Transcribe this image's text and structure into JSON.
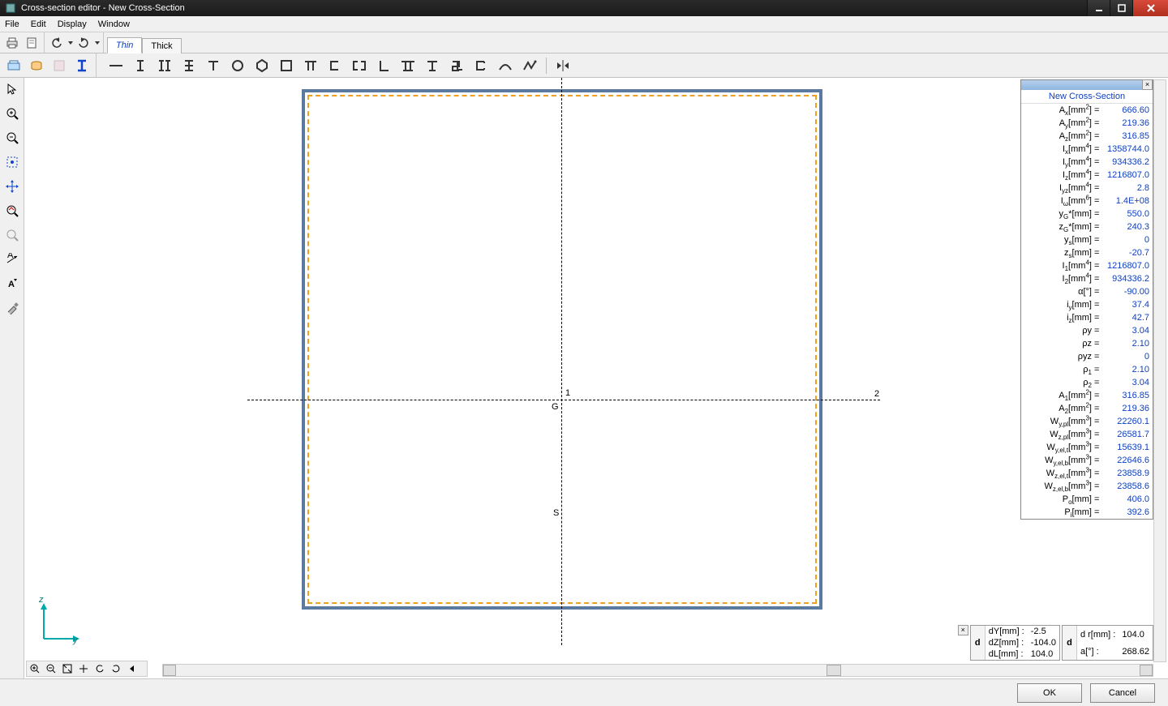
{
  "title": "Cross-section editor - New Cross-Section",
  "menus": [
    "File",
    "Edit",
    "Display",
    "Window"
  ],
  "tabs": {
    "thin": "Thin",
    "thick": "Thick"
  },
  "footer": {
    "ok": "OK",
    "cancel": "Cancel"
  },
  "section_name": "New Cross-Section",
  "canvas_labels": {
    "one": "1",
    "two": "2",
    "G": "G",
    "S": "S",
    "z": "z",
    "y": "y"
  },
  "properties": [
    {
      "label": "A<sub>x</sub>[mm<sup>2</sup>] =",
      "value": "666.60"
    },
    {
      "label": "A<sub>y</sub>[mm<sup>2</sup>] =",
      "value": "219.36"
    },
    {
      "label": "A<sub>z</sub>[mm<sup>2</sup>] =",
      "value": "316.85"
    },
    {
      "label": "I<sub>x</sub>[mm<sup>4</sup>] =",
      "value": "1358744.0"
    },
    {
      "label": "I<sub>y</sub>[mm<sup>4</sup>] =",
      "value": "934336.2"
    },
    {
      "label": "I<sub>z</sub>[mm<sup>4</sup>] =",
      "value": "1216807.0"
    },
    {
      "label": "I<sub>yz</sub>[mm<sup>4</sup>] =",
      "value": "2.8"
    },
    {
      "label": "I<sub>ω</sub>[mm<sup>6</sup>] =",
      "value": "1.4E+08"
    },
    {
      "label": "y<sub>G</sub>*[mm] =",
      "value": "550.0"
    },
    {
      "label": "z<sub>G</sub>*[mm] =",
      "value": "240.3"
    },
    {
      "label": "y<sub>s</sub>[mm] =",
      "value": "0"
    },
    {
      "label": "z<sub>s</sub>[mm] =",
      "value": "-20.7"
    },
    {
      "label": "I<sub>1</sub>[mm<sup>4</sup>] =",
      "value": "1216807.0"
    },
    {
      "label": "I<sub>2</sub>[mm<sup>4</sup>] =",
      "value": "934336.2"
    },
    {
      "label": "α[°] =",
      "value": "-90.00"
    },
    {
      "label": "i<sub>y</sub>[mm] =",
      "value": "37.4"
    },
    {
      "label": "i<sub>z</sub>[mm] =",
      "value": "42.7"
    },
    {
      "label": "ρy =",
      "value": "3.04"
    },
    {
      "label": "ρz =",
      "value": "2.10"
    },
    {
      "label": "ρyz =",
      "value": "0"
    },
    {
      "label": "ρ<sub>1</sub> =",
      "value": "2.10"
    },
    {
      "label": "ρ<sub>2</sub> =",
      "value": "3.04"
    },
    {
      "label": "A<sub>1</sub>[mm<sup>2</sup>] =",
      "value": "316.85"
    },
    {
      "label": "A<sub>2</sub>[mm<sup>2</sup>] =",
      "value": "219.36"
    },
    {
      "label": "W<sub>y,pl</sub>[mm<sup>3</sup>] =",
      "value": "22260.1"
    },
    {
      "label": "W<sub>z,pl</sub>[mm<sup>3</sup>] =",
      "value": "26581.7"
    },
    {
      "label": "W<sub>y,el,t</sub>[mm<sup>3</sup>] =",
      "value": "15639.1"
    },
    {
      "label": "W<sub>y,el,b</sub>[mm<sup>3</sup>] =",
      "value": "22646.6"
    },
    {
      "label": "W<sub>z,el,t</sub>[mm<sup>3</sup>] =",
      "value": "23858.9"
    },
    {
      "label": "W<sub>z,el,b</sub>[mm<sup>3</sup>] =",
      "value": "23858.6"
    },
    {
      "label": "P<sub>o</sub>[mm] =",
      "value": "406.0"
    },
    {
      "label": "P<sub>i</sub>[mm] =",
      "value": "392.6"
    }
  ],
  "status_d1": [
    {
      "k": "dY[mm] :",
      "v": "-2.5"
    },
    {
      "k": "dZ[mm] :",
      "v": "-104.0"
    },
    {
      "k": "dL[mm] :",
      "v": "104.0"
    }
  ],
  "status_d2": [
    {
      "k": "d r[mm] :",
      "v": "104.0"
    },
    {
      "k": "a[°] :",
      "v": "268.62"
    }
  ]
}
